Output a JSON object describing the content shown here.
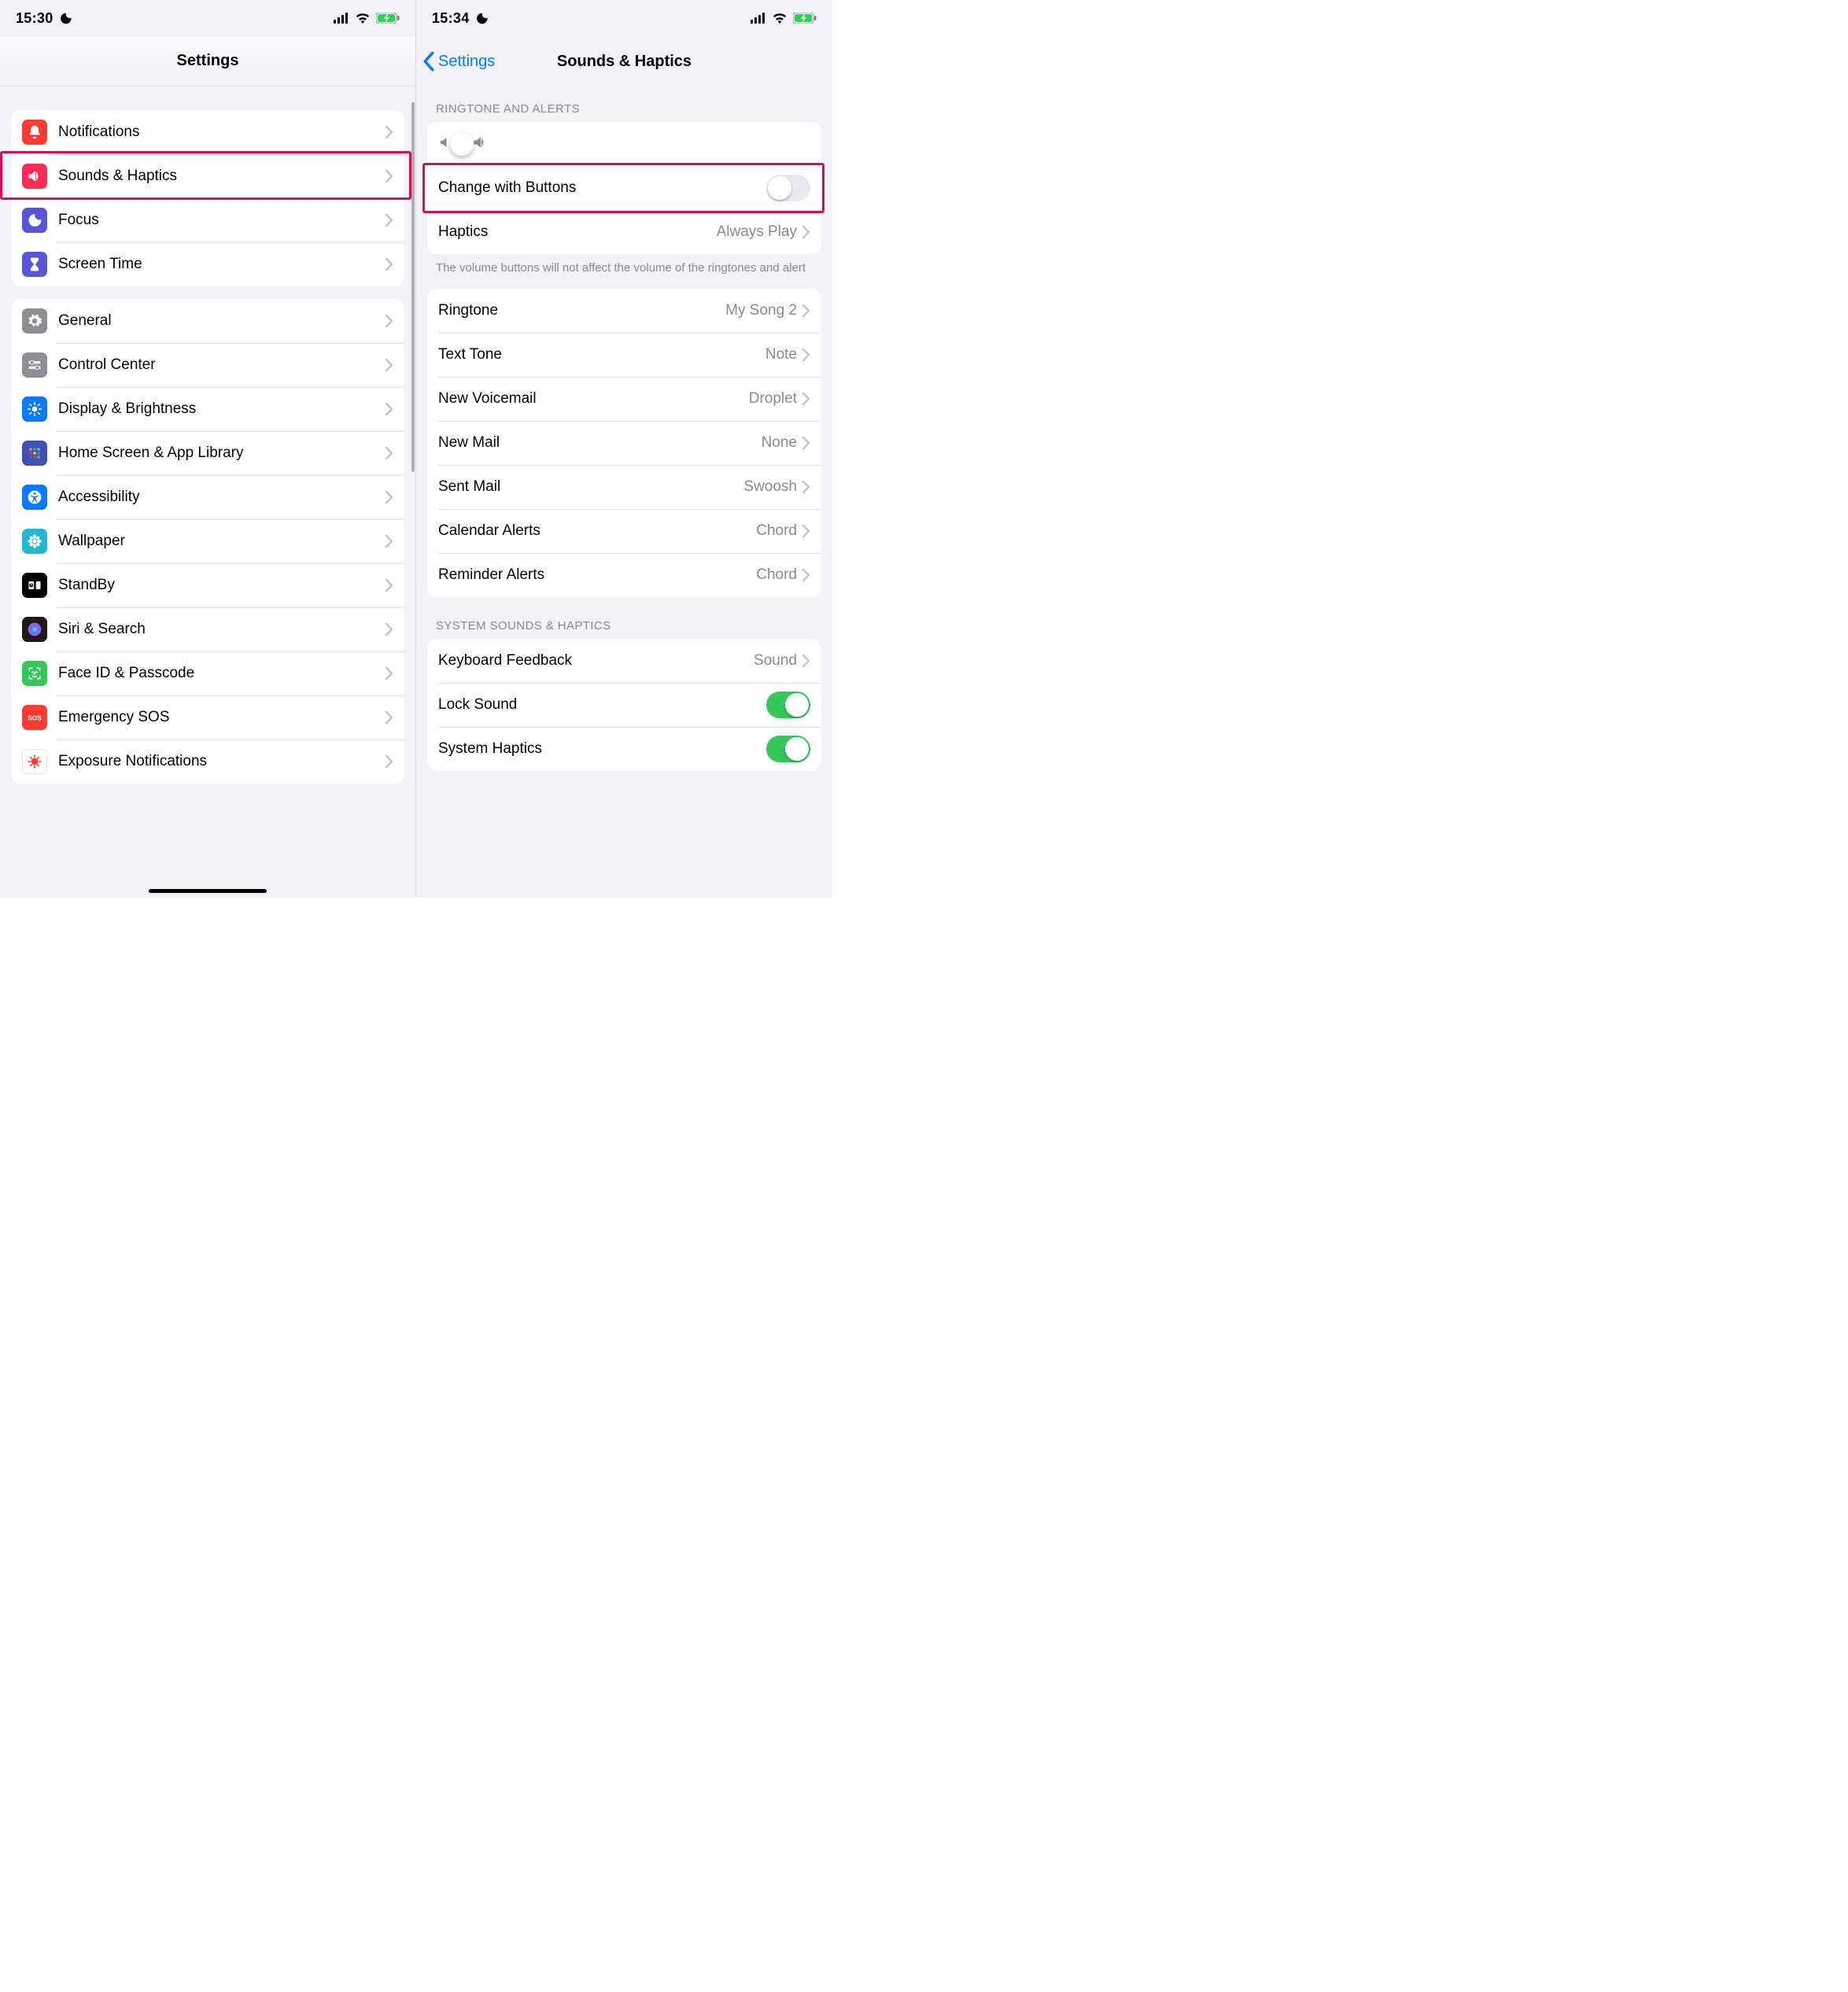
{
  "left": {
    "status_time": "15:30",
    "nav_title": "Settings",
    "group1": [
      {
        "id": "notifications",
        "label": "Notifications",
        "bg": "#ff3b30",
        "icon": "bell"
      },
      {
        "id": "sounds-haptics",
        "label": "Sounds & Haptics",
        "bg": "#ff2d55",
        "icon": "speaker"
      },
      {
        "id": "focus",
        "label": "Focus",
        "bg": "#5856d6",
        "icon": "moon"
      },
      {
        "id": "screen-time",
        "label": "Screen Time",
        "bg": "#5856d6",
        "icon": "hourglass"
      }
    ],
    "group2": [
      {
        "id": "general",
        "label": "General",
        "bg": "#8e8e93",
        "icon": "gear"
      },
      {
        "id": "control-center",
        "label": "Control Center",
        "bg": "#8e8e93",
        "icon": "sliders"
      },
      {
        "id": "display-brightness",
        "label": "Display & Brightness",
        "bg": "#0a7aff",
        "icon": "sun"
      },
      {
        "id": "home-screen",
        "label": "Home Screen & App Library",
        "bg": "#3f51b5",
        "icon": "grid"
      },
      {
        "id": "accessibility",
        "label": "Accessibility",
        "bg": "#0a7aff",
        "icon": "access"
      },
      {
        "id": "wallpaper",
        "label": "Wallpaper",
        "bg": "#22b8cf",
        "icon": "flower"
      },
      {
        "id": "standby",
        "label": "StandBy",
        "bg": "#000000",
        "icon": "standby"
      },
      {
        "id": "siri-search",
        "label": "Siri & Search",
        "bg": "#siri",
        "icon": "siri"
      },
      {
        "id": "faceid",
        "label": "Face ID & Passcode",
        "bg": "#34c759",
        "icon": "face"
      },
      {
        "id": "emergency-sos",
        "label": "Emergency SOS",
        "bg": "#ff3b30",
        "icon": "sos"
      },
      {
        "id": "exposure",
        "label": "Exposure Notifications",
        "bg": "#ffffff",
        "icon": "covid"
      }
    ]
  },
  "right": {
    "status_time": "15:34",
    "back_label": "Settings",
    "nav_title": "Sounds & Haptics",
    "header_ringtone": "RINGTONE AND ALERTS",
    "slider_percent": 40,
    "change_label": "Change with Buttons",
    "change_on": false,
    "haptics_label": "Haptics",
    "haptics_value": "Always Play",
    "footer_ringtone": "The volume buttons will not affect the volume of the ringtones and alert",
    "sounds": [
      {
        "id": "ringtone",
        "label": "Ringtone",
        "value": "My Song 2"
      },
      {
        "id": "text-tone",
        "label": "Text Tone",
        "value": "Note"
      },
      {
        "id": "new-voicemail",
        "label": "New Voicemail",
        "value": "Droplet"
      },
      {
        "id": "new-mail",
        "label": "New Mail",
        "value": "None"
      },
      {
        "id": "sent-mail",
        "label": "Sent Mail",
        "value": "Swoosh"
      },
      {
        "id": "calendar-alerts",
        "label": "Calendar Alerts",
        "value": "Chord"
      },
      {
        "id": "reminder-alerts",
        "label": "Reminder Alerts",
        "value": "Chord"
      }
    ],
    "header_system": "SYSTEM SOUNDS & HAPTICS",
    "keyboard_label": "Keyboard Feedback",
    "keyboard_value": "Sound",
    "lock_label": "Lock Sound",
    "lock_on": true,
    "system_haptics_label": "System Haptics",
    "system_haptics_on": true
  }
}
